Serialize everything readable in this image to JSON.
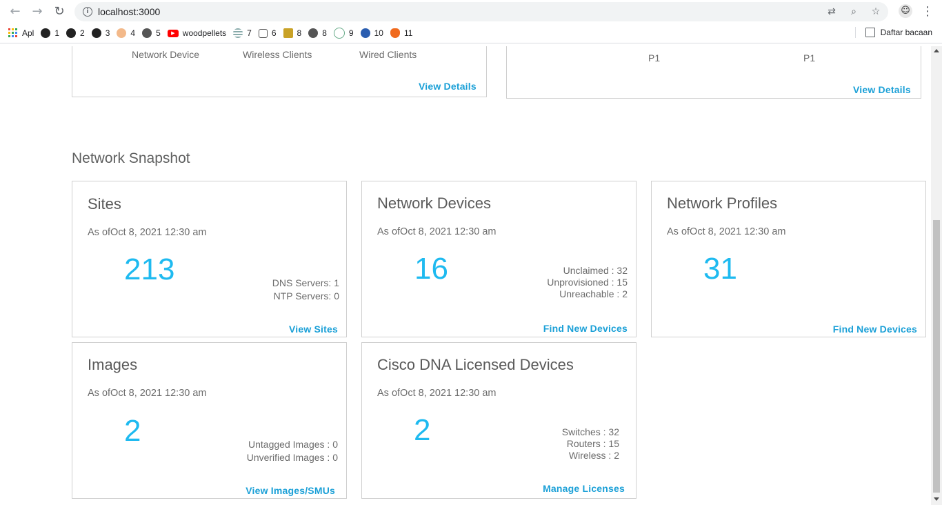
{
  "browser": {
    "url": "localhost:3000",
    "bookmarks": [
      {
        "label": "Apl",
        "icon": "apps-grid-icon"
      },
      {
        "label": "1",
        "icon": "github-icon"
      },
      {
        "label": "2",
        "icon": "github-icon"
      },
      {
        "label": "3",
        "icon": "github-icon"
      },
      {
        "label": "4",
        "icon": "fish-icon"
      },
      {
        "label": "5",
        "icon": "globe-icon"
      },
      {
        "label": "woodpellets",
        "icon": "youtube-icon"
      },
      {
        "label": "7",
        "icon": "striped-globe-icon"
      },
      {
        "label": "6",
        "icon": "database-icon"
      },
      {
        "label": "8",
        "icon": "badge-icon"
      },
      {
        "label": "8",
        "icon": "globe-icon"
      },
      {
        "label": "9",
        "icon": "ring-logo-icon"
      },
      {
        "label": "10",
        "icon": "blue-logo-icon"
      },
      {
        "label": "11",
        "icon": "flame-icon"
      }
    ],
    "reading_list": "Daftar bacaan"
  },
  "top_cards": {
    "left": {
      "labels": [
        "Network Device",
        "Wireless Clients",
        "Wired Clients"
      ],
      "link": "View Details"
    },
    "right": {
      "labels": [
        "P1",
        "P1"
      ],
      "link": "View Details"
    }
  },
  "snapshot": {
    "title": "Network Snapshot",
    "cards": {
      "sites": {
        "title": "Sites",
        "asof": "As ofOct 8, 2021 12:30 am",
        "count": "213",
        "stats": [
          "DNS Servers: 1",
          "NTP Servers: 0"
        ],
        "link": "View Sites"
      },
      "devices": {
        "title": "Network Devices",
        "asof": "As ofOct 8, 2021 12:30 am",
        "count": "16",
        "stats": [
          "Unclaimed : 32",
          "Unprovisioned : 15",
          "Unreachable : 2"
        ],
        "link": "Find New Devices"
      },
      "profiles": {
        "title": "Network Profiles",
        "asof": "As ofOct 8, 2021 12:30 am",
        "count": "31",
        "link": "Find New Devices"
      },
      "images": {
        "title": "Images",
        "asof": "As ofOct 8, 2021 12:30 am",
        "count": "2",
        "stats": [
          "Untagged Images : 0",
          "Unverified Images : 0"
        ],
        "link": "View Images/SMUs"
      },
      "licensed": {
        "title": "Cisco DNA Licensed Devices",
        "asof": "As ofOct 8, 2021 12:30 am",
        "count": "2",
        "stats": [
          "Switches : 32",
          "Routers : 15",
          "Wireless : 2"
        ],
        "link": "Manage Licenses"
      }
    }
  },
  "colors": {
    "accent_number": "#1ebaf0",
    "link": "#1ba0d7",
    "border": "#cfcfcf"
  }
}
